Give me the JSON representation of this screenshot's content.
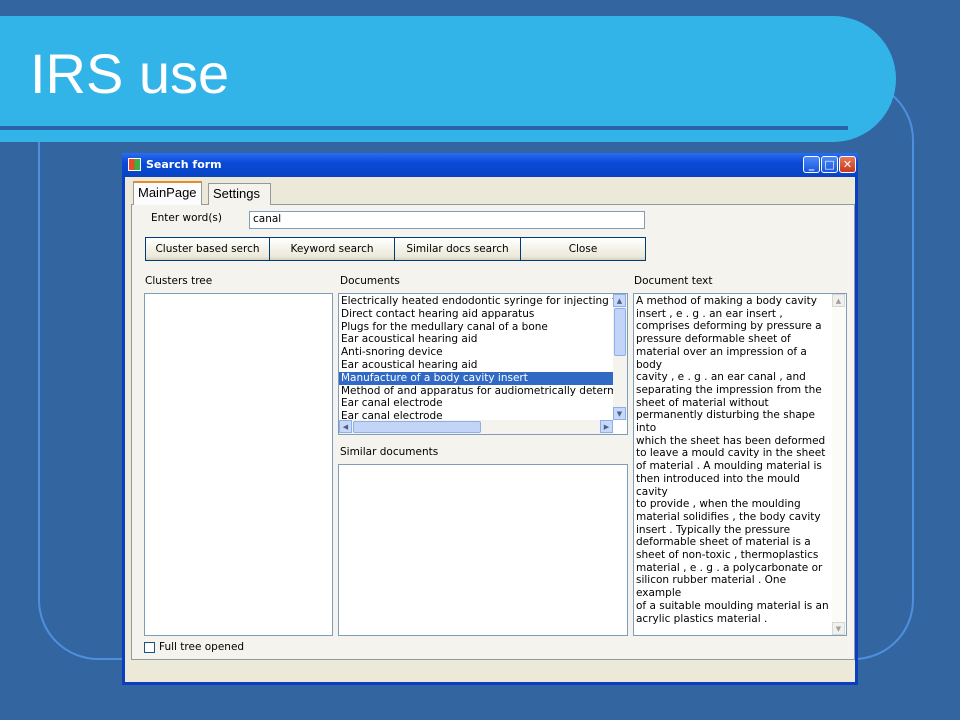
{
  "slide": {
    "title": "IRS use"
  },
  "window": {
    "title": "Search form",
    "controls": {
      "minimize": "_",
      "maximize": "□",
      "close": "✕"
    }
  },
  "tabs": [
    {
      "label": "MainPage",
      "active": true
    },
    {
      "label": "Settings",
      "active": false
    }
  ],
  "search": {
    "label": "Enter word(s)",
    "value": "canal"
  },
  "buttons": {
    "cluster": "Cluster based serch",
    "keyword": "Keyword search",
    "similar": "Similar docs search",
    "close": "Close"
  },
  "clusters": {
    "label": "Clusters tree"
  },
  "documents": {
    "label": "Documents",
    "items": [
      "Electrically heated endodontic syringe for injecting th",
      "Direct contact hearing aid apparatus",
      "Plugs for the medullary canal of a bone",
      "Ear acoustical hearing aid",
      "Anti-snoring device",
      "Ear acoustical hearing aid",
      "Manufacture of a body cavity insert",
      "Method of and apparatus for audiometrically determi",
      "Ear canal electrode",
      "Ear canal electrode"
    ],
    "selected_index": 6
  },
  "similar_documents": {
    "label": "Similar documents"
  },
  "document_text": {
    "label": "Document text",
    "lines": [
      "A method of making a body cavity",
      "insert , e . g . an ear insert ,",
      "comprises deforming by pressure a",
      "pressure deformable sheet of",
      "material over an impression of a body",
      "cavity , e . g . an ear canal , and",
      "separating the impression from the",
      "sheet of material without",
      "permanently disturbing the shape into",
      "which the sheet has been deformed",
      "to leave a mould cavity in the sheet",
      "of material . A moulding material is",
      "then introduced into the mould cavity",
      "to provide , when the moulding",
      "material solidifies , the body cavity",
      "insert . Typically the pressure",
      "deformable sheet of material is a",
      "sheet of non-toxic , thermoplastics",
      "material , e . g . a polycarbonate or",
      "silicon rubber material . One example",
      "of a suitable moulding material is an",
      "acrylic plastics material ."
    ]
  },
  "full_tree": {
    "label": "Full tree opened",
    "checked": false
  },
  "icons": [
    "app-icon",
    "minimize-icon",
    "maximize-icon",
    "close-icon",
    "scroll-up-arrow-icon",
    "scroll-down-arrow-icon",
    "scroll-left-arrow-icon",
    "scroll-right-arrow-icon"
  ]
}
